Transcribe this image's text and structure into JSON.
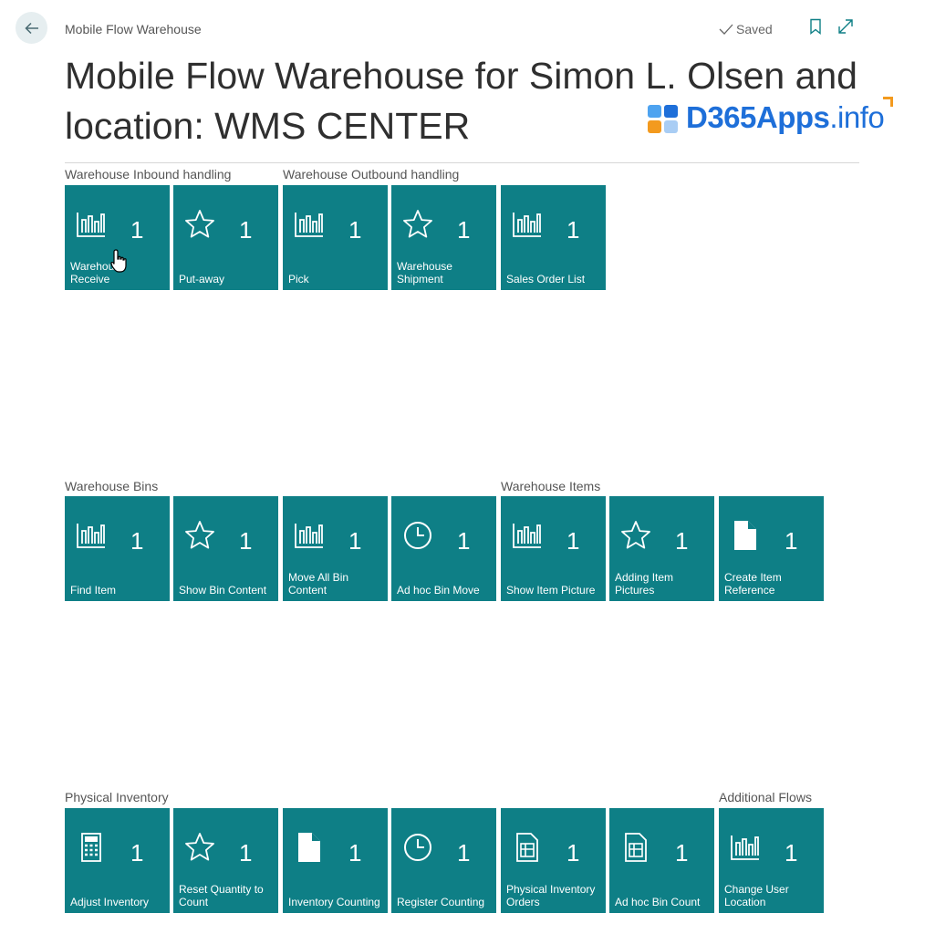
{
  "header": {
    "breadcrumb": "Mobile Flow Warehouse",
    "saved_label": "Saved",
    "icons": [
      "back-arrow-icon",
      "checkmark-icon",
      "bookmark-icon",
      "expand-icon"
    ]
  },
  "page": {
    "title": "Mobile Flow Warehouse for Simon L. Olsen and location: WMS CENTER"
  },
  "watermark": {
    "brand": "D365Apps",
    "tld": ".info"
  },
  "groups": [
    {
      "title": "Warehouse Inbound handling"
    },
    {
      "title": "Warehouse Outbound handling"
    },
    {
      "title": "Warehouse Bins"
    },
    {
      "title": "Warehouse Items"
    },
    {
      "title": "Physical Inventory"
    },
    {
      "title": "Additional Flows"
    }
  ],
  "tiles": [
    {
      "label": "Warehouse Receive",
      "count": "1",
      "icon": "bar-chart-icon"
    },
    {
      "label": "Put-away",
      "count": "1",
      "icon": "star-icon"
    },
    {
      "label": "Pick",
      "count": "1",
      "icon": "bar-chart-icon"
    },
    {
      "label": "Warehouse Shipment",
      "count": "1",
      "icon": "star-icon"
    },
    {
      "label": "Sales Order List",
      "count": "1",
      "icon": "bar-chart-icon"
    },
    {
      "label": "Find Item",
      "count": "1",
      "icon": "bar-chart-icon"
    },
    {
      "label": "Show Bin Content",
      "count": "1",
      "icon": "star-icon"
    },
    {
      "label": "Move All Bin Content",
      "count": "1",
      "icon": "bar-chart-icon"
    },
    {
      "label": "Ad hoc Bin Move",
      "count": "1",
      "icon": "clock-icon"
    },
    {
      "label": "Show Item Picture",
      "count": "1",
      "icon": "bar-chart-icon"
    },
    {
      "label": "Adding Item Pictures",
      "count": "1",
      "icon": "star-icon"
    },
    {
      "label": "Create Item Reference",
      "count": "1",
      "icon": "document-icon"
    },
    {
      "label": "Adjust Inventory",
      "count": "1",
      "icon": "calculator-icon"
    },
    {
      "label": "Reset Quantity to Count",
      "count": "1",
      "icon": "star-icon"
    },
    {
      "label": "Inventory Counting",
      "count": "1",
      "icon": "document-icon"
    },
    {
      "label": "Register Counting",
      "count": "1",
      "icon": "clock-icon"
    },
    {
      "label": "Physical Inventory Orders",
      "count": "1",
      "icon": "report-icon"
    },
    {
      "label": "Ad hoc Bin Count",
      "count": "1",
      "icon": "report-icon"
    },
    {
      "label": "Change User Location",
      "count": "1",
      "icon": "bar-chart-icon"
    }
  ],
  "colors": {
    "tile": "#0e7f86",
    "brand_blue": "#1e6fd9",
    "brand_orange": "#f39a1e"
  }
}
